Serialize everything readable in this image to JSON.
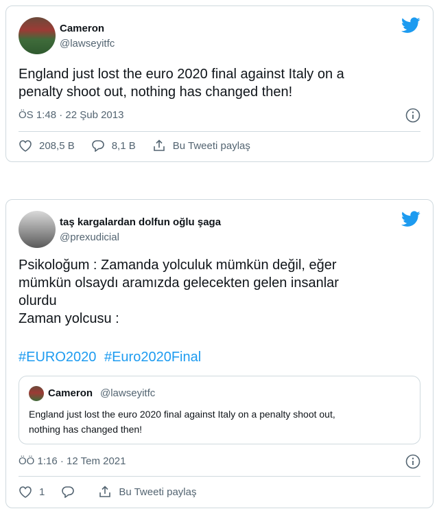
{
  "tweet1": {
    "name": "Cameron",
    "handle": "@lawseyitfc",
    "text": "England just lost the euro 2020 final against Italy on a\npenalty shoot out, nothing has changed then!",
    "timestamp": "ÖS 1:48 · 22 Şub 2013",
    "likes": "208,5 B",
    "replies": "8,1 B",
    "share_label": "Bu Tweeti paylaş"
  },
  "tweet2": {
    "name": "taş kargalardan dolfun oğlu şaga",
    "handle": "@prexudicial",
    "text": "Psikoloğum : Zamanda yolculuk mümkün değil, eğer\nmümkün olsaydı aramızda gelecekten gelen insanlar\nolurdu\nZaman yolcusu :",
    "hashtags": [
      "#EURO2020",
      "#Euro2020Final"
    ],
    "quote": {
      "name": "Cameron",
      "handle": "@lawseyitfc",
      "text": "England just lost the euro 2020 final against Italy on a penalty shoot out,\nnothing has changed then!"
    },
    "timestamp": "ÖÖ 1:16 · 12 Tem 2021",
    "likes": "1",
    "share_label": "Bu Tweeti paylaş"
  },
  "colors": {
    "twitter_blue": "#1d9bf0",
    "secondary_text": "#536471",
    "border": "#cfd9de"
  },
  "icons": [
    "twitter-bird-icon",
    "info-icon",
    "heart-icon",
    "reply-icon",
    "share-icon"
  ]
}
